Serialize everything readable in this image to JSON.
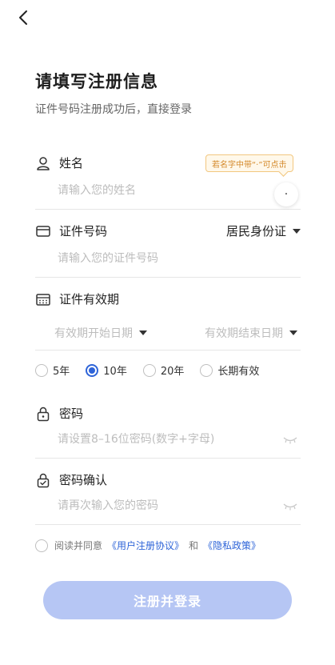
{
  "header": {
    "back_icon": "chevron-left-icon",
    "title": "请填写注册信息",
    "subtitle": "证件号码注册成功后，直接登录"
  },
  "name": {
    "label": "姓名",
    "icon": "user-icon",
    "placeholder": "请输入您的姓名",
    "tooltip": "若名字中带“·”可点击",
    "dot_button": "·"
  },
  "id_number": {
    "label": "证件号码",
    "icon": "card-icon",
    "type_selected": "居民身份证",
    "placeholder": "请输入您的证件号码"
  },
  "validity": {
    "label": "证件有效期",
    "icon": "calendar-icon",
    "start_placeholder": "有效期开始日期",
    "end_placeholder": "有效期结束日期",
    "options": [
      "5年",
      "10年",
      "20年",
      "长期有效"
    ],
    "selected": "10年"
  },
  "password": {
    "label": "密码",
    "icon": "lock-icon",
    "placeholder": "请设置8–16位密码(数字+字母)"
  },
  "password_confirm": {
    "label": "密码确认",
    "icon": "lock-check-icon",
    "placeholder": "请再次输入您的密码"
  },
  "agreement": {
    "prefix": "阅读并同意",
    "user_agreement": "《用户注册协议》",
    "and": "和",
    "privacy_policy": "《隐私政策》"
  },
  "submit_label": "注册并登录",
  "colors": {
    "accent": "#2e64d8",
    "button_disabled": "#b6c6f4",
    "tooltip_text": "#d4892a"
  }
}
